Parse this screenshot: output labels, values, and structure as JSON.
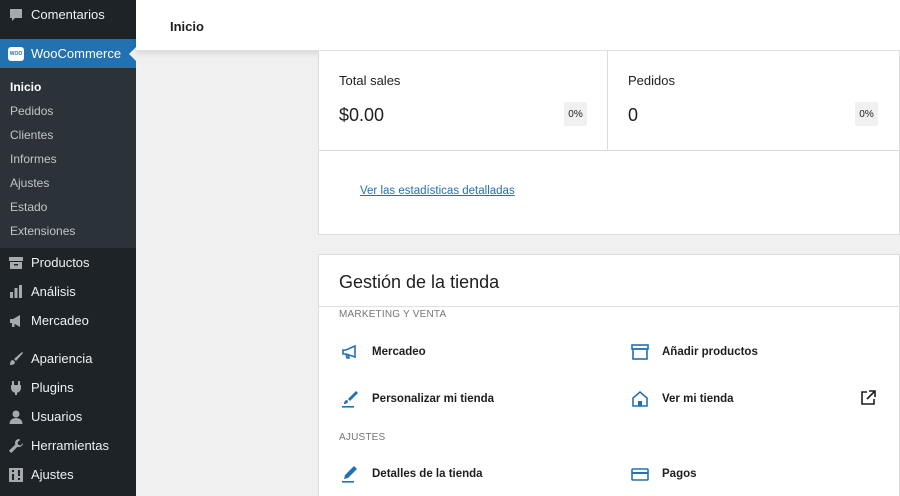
{
  "sidebar": {
    "comments_label": "Comentarios",
    "woocommerce_label": "WooCommerce",
    "woo_badge": "WOO",
    "submenu": [
      "Inicio",
      "Pedidos",
      "Clientes",
      "Informes",
      "Ajustes",
      "Estado",
      "Extensiones"
    ],
    "products_label": "Productos",
    "analytics_label": "Análisis",
    "marketing_label": "Mercadeo",
    "appearance_label": "Apariencia",
    "plugins_label": "Plugins",
    "users_label": "Usuarios",
    "tools_label": "Herramientas",
    "settings_label": "Ajustes"
  },
  "header": {
    "title": "Inicio"
  },
  "stats": {
    "items": [
      {
        "label": "Total sales",
        "value": "$0.00",
        "delta": "0%"
      },
      {
        "label": "Pedidos",
        "value": "0",
        "delta": "0%"
      }
    ],
    "link": "Ver las estadísticas detalladas"
  },
  "store": {
    "title": "Gestión de la tienda",
    "sections": [
      {
        "label": "MARKETING Y VENTA",
        "items": [
          {
            "label": "Mercadeo",
            "icon": "megaphone-icon"
          },
          {
            "label": "Añadir productos",
            "icon": "archive-icon"
          },
          {
            "label": "Personalizar mi tienda",
            "icon": "brush-icon"
          },
          {
            "label": "Ver mi tienda",
            "icon": "store-icon"
          }
        ]
      },
      {
        "label": "AJUSTES",
        "items": [
          {
            "label": "Detalles de la tienda",
            "icon": "pencil-icon"
          },
          {
            "label": "Pagos",
            "icon": "credit-card-icon"
          }
        ]
      }
    ]
  },
  "colors": {
    "sidebar_bg": "#1d2327",
    "submenu_bg": "#2c3338",
    "accent": "#2271b1",
    "page_bg": "#f0f0f1"
  }
}
